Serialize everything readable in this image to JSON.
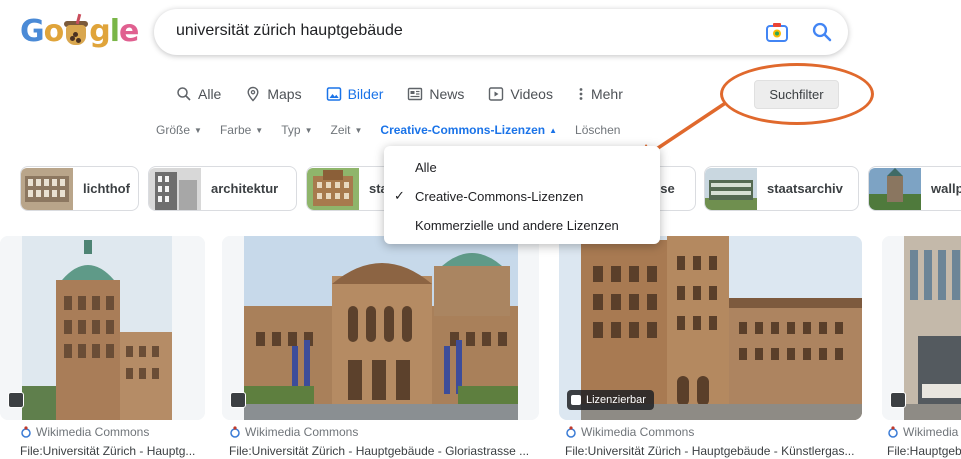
{
  "logo": {
    "letters": [
      "G",
      "o",
      "g",
      "l",
      "e"
    ]
  },
  "search": {
    "query": "universität zürich hauptgebäude"
  },
  "tabs": [
    {
      "label": "Alle",
      "icon": "search-icon",
      "active": false
    },
    {
      "label": "Maps",
      "icon": "pin-icon",
      "active": false
    },
    {
      "label": "Bilder",
      "icon": "image-icon",
      "active": true
    },
    {
      "label": "News",
      "icon": "news-icon",
      "active": false
    },
    {
      "label": "Videos",
      "icon": "play-icon",
      "active": false
    },
    {
      "label": "Mehr",
      "icon": "more-vert-icon",
      "active": false
    }
  ],
  "suchfilter": "Suchfilter",
  "filters": [
    {
      "label": "Größe"
    },
    {
      "label": "Farbe"
    },
    {
      "label": "Typ"
    },
    {
      "label": "Zeit"
    },
    {
      "label": "Creative-Commons-Lizenzen",
      "active": true
    },
    {
      "label": "Löschen"
    }
  ],
  "chips": [
    {
      "label": "lichthof"
    },
    {
      "label": "architektur"
    },
    {
      "label": "sta"
    },
    {
      "label": "sse"
    },
    {
      "label": "staatsarchiv"
    },
    {
      "label": "wallp"
    }
  ],
  "dropdown": {
    "items": [
      {
        "label": "Alle",
        "checked": false
      },
      {
        "label": "Creative-Commons-Lizenzen",
        "checked": true
      },
      {
        "label": "Kommerzielle und andere Lizenzen",
        "checked": false
      }
    ]
  },
  "results": [
    {
      "source": "Wikimedia Commons",
      "title": "File:Universität Zürich - Hauptg..."
    },
    {
      "source": "Wikimedia Commons",
      "title": "File:Universität Zürich - Hauptgebäude - Gloriastrasse ..."
    },
    {
      "source": "Wikimedia Commons",
      "title": "File:Universität Zürich - Hauptgebäude - Künstlergas...",
      "badge": "Lizenzierbar"
    },
    {
      "source": "Wikimedia",
      "title": "File:Hauptgeb"
    }
  ],
  "colors": {
    "accent": "#1a73e8",
    "annotation": "#e0692d"
  }
}
